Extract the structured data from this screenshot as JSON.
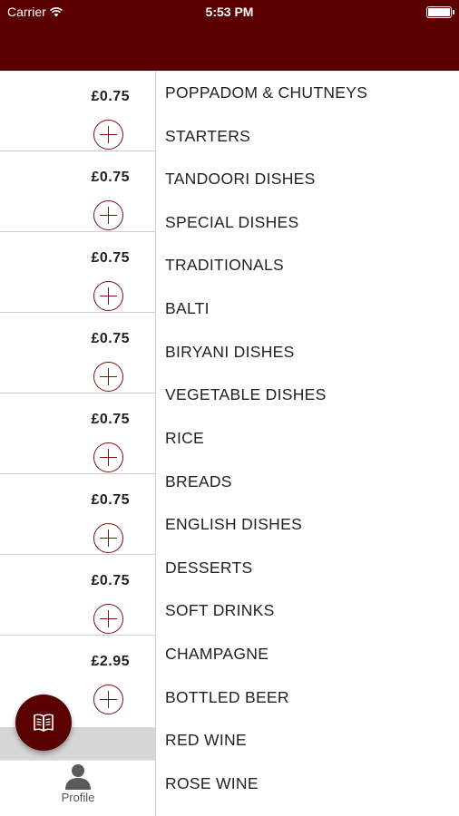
{
  "status_bar": {
    "carrier": "Carrier",
    "time": "5:53 PM"
  },
  "items": [
    {
      "price": "£0.75"
    },
    {
      "price": "£0.75"
    },
    {
      "price": "£0.75"
    },
    {
      "price": "£0.75"
    },
    {
      "price": "£0.75"
    },
    {
      "price": "£0.75"
    },
    {
      "price": "£0.75"
    },
    {
      "price": "£2.95"
    }
  ],
  "tab_bar": {
    "profile_label": "Profile"
  },
  "fab": {
    "icon": "menu-book-icon"
  },
  "categories": [
    "POPPADOM & CHUTNEYS",
    "STARTERS",
    "TANDOORI DISHES",
    "SPECIAL DISHES",
    "TRADITIONALS",
    "BALTI",
    "BIRYANI DISHES",
    "VEGETABLE DISHES",
    "RICE",
    "BREADS",
    "ENGLISH DISHES",
    "DESSERTS",
    "SOFT DRINKS",
    "CHAMPAGNE",
    "BOTTLED BEER",
    "RED WINE",
    "ROSE WINE"
  ],
  "colors": {
    "brand": "#5b0000",
    "accent": "#7a1010"
  }
}
